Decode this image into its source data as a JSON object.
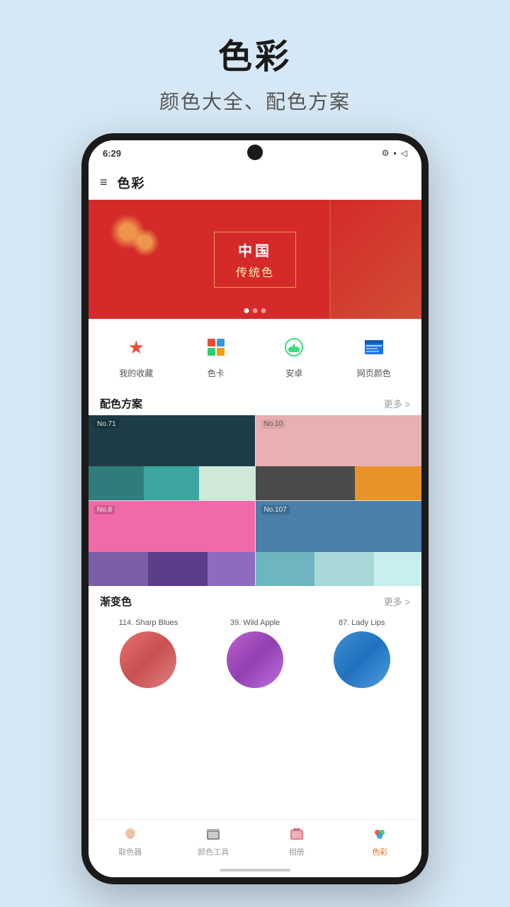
{
  "page": {
    "title": "色彩",
    "subtitle": "颜色大全、配色方案"
  },
  "status_bar": {
    "time": "6:29",
    "icons": [
      "⚙",
      "⬛",
      "▷"
    ]
  },
  "app_bar": {
    "menu_label": "≡",
    "title": "色彩"
  },
  "banner": {
    "line1": "中国",
    "line2": "传统色",
    "dots": [
      true,
      false,
      false
    ]
  },
  "categories": [
    {
      "id": "favorites",
      "icon": "⭐",
      "icon_color": "#e74c3c",
      "label": "我的收藏"
    },
    {
      "id": "color-card",
      "icon": "🎨",
      "icon_color": "#e74c3c",
      "label": "色卡"
    },
    {
      "id": "android",
      "icon": "🤖",
      "icon_color": "#3ddc84",
      "label": "安卓"
    },
    {
      "id": "web-colors",
      "icon": "🌐",
      "icon_color": "#1a73e8",
      "label": "网页颜色"
    }
  ],
  "color_schemes": {
    "section_title": "配色方案",
    "more_label": "更多 >",
    "items": [
      {
        "id": "71",
        "label": "No.71"
      },
      {
        "id": "10",
        "label": "No.10"
      },
      {
        "id": "8",
        "label": "No.8"
      },
      {
        "id": "107",
        "label": "No.107"
      }
    ]
  },
  "gradients": {
    "section_title": "渐变色",
    "more_label": "更多 >",
    "items": [
      {
        "id": "114",
        "label": "114. Sharp Blues"
      },
      {
        "id": "39",
        "label": "39. Wild Apple"
      },
      {
        "id": "87",
        "label": "87. Lady Lips"
      }
    ]
  },
  "bottom_nav": {
    "items": [
      {
        "id": "eyedropper",
        "icon": "💧",
        "label": "取色器",
        "active": false
      },
      {
        "id": "color-tools",
        "icon": "🖨",
        "label": "颜色工具",
        "active": false
      },
      {
        "id": "album",
        "icon": "🗂",
        "label": "相册",
        "active": false
      },
      {
        "id": "color",
        "icon": "🍎",
        "label": "色彩",
        "active": true
      }
    ]
  }
}
